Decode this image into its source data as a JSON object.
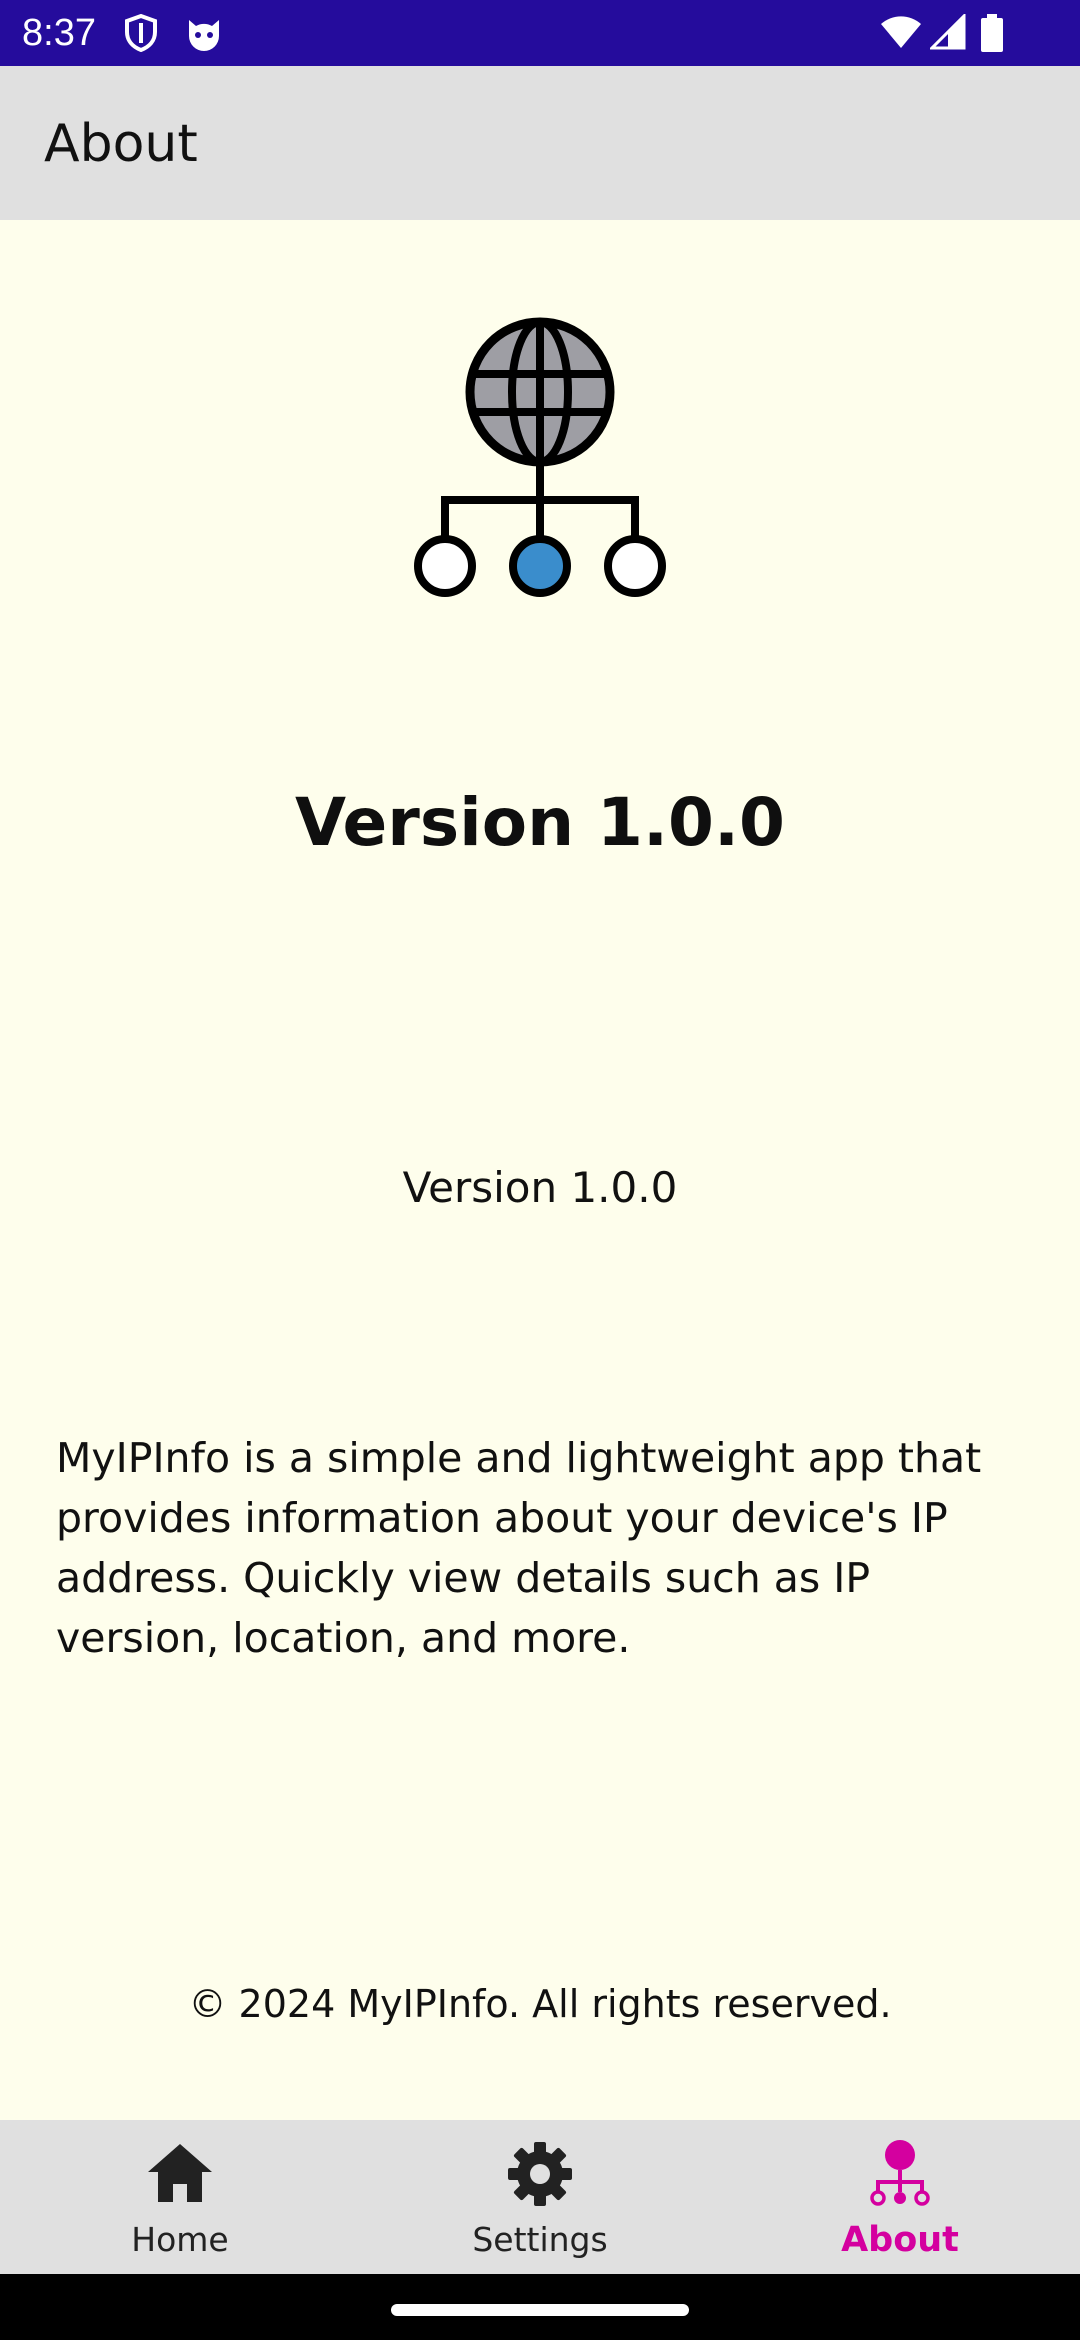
{
  "status_bar": {
    "time": "8:37",
    "icons": [
      "shield-icon",
      "cat-icon",
      "wifi-icon",
      "signal-icon",
      "battery-icon"
    ],
    "background": "#250c9c"
  },
  "app_bar": {
    "title": "About"
  },
  "content": {
    "logo_icon": "network-globe-icon",
    "version_heading": "Version 1.0.0",
    "version_sub": "Version 1.0.0",
    "description": "MyIPInfo is a simple and lightweight app that provides information about your device's IP address. Quickly view details such as IP version, location, and more.",
    "copyright": "© 2024 MyIPInfo. All rights reserved."
  },
  "bottom_nav": {
    "items": [
      {
        "label": "Home",
        "icon": "home-icon",
        "active": false
      },
      {
        "label": "Settings",
        "icon": "gear-icon",
        "active": false
      },
      {
        "label": "About",
        "icon": "network-icon",
        "active": true
      }
    ]
  },
  "colors": {
    "background": "#fefeec",
    "bar": "#e0e0e0",
    "accent": "#d4009f",
    "logo_globe": "#9e9ea4",
    "logo_node": "#3a8dcc"
  }
}
